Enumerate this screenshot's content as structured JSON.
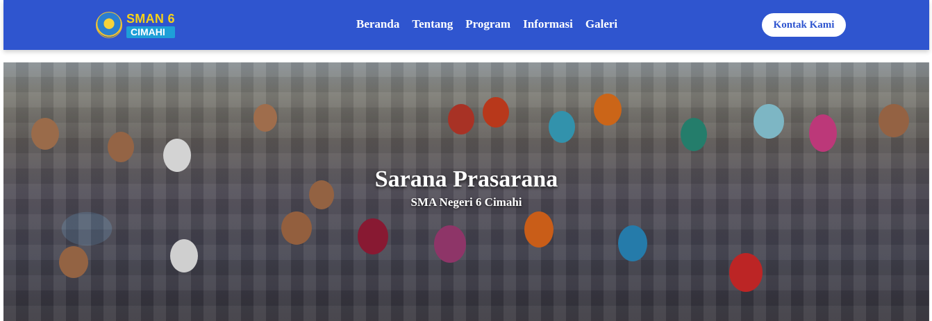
{
  "logo": {
    "line1": "SMAN 6",
    "line2": "CIMAHI"
  },
  "nav": {
    "items": [
      "Beranda",
      "Tentang",
      "Program",
      "Informasi",
      "Galeri"
    ]
  },
  "contact_button": "Kontak Kami",
  "hero": {
    "title": "Sarana Prasarana",
    "subtitle": "SMA Negeri 6 Cimahi"
  },
  "colors": {
    "navbar": "#2f55cf",
    "logo_yellow": "#f7d117",
    "logo_blue": "#1e9fd8"
  }
}
